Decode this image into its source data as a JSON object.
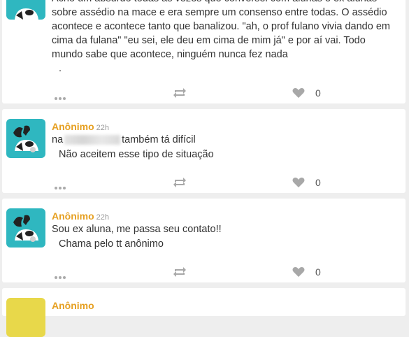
{
  "posts": [
    {
      "lines": [
        "Acho um absurdo todas as vezes que conversei com alunas e ex alunas",
        "sobre assédio na mace e era sempre um consenso entre todas. O assédio",
        "acontece e acontece tanto que banalizou. \"ah, o prof fulano vivia dando em",
        "cima da fulana\" \"eu sei, ele deu em cima de mim já\" e por aí vai. Todo",
        "mundo sabe que acontece, ninguém nunca fez nada"
      ],
      "trailing": ".",
      "likes": "0"
    },
    {
      "author": "Anônimo",
      "time": "22h",
      "line_prefix": "na",
      "line_suffix": "também tá difícil",
      "reply": "Não aceitem esse tipo de situação",
      "likes": "0"
    },
    {
      "author": "Anônimo",
      "time": "22h",
      "text": "Sou ex aluna, me passa seu contato!!",
      "reply": "Chama pelo tt anônimo",
      "likes": "0"
    },
    {
      "author": "Anônimo"
    }
  ],
  "icons": {
    "more": "more-dots-icon",
    "repost": "repost-icon",
    "like": "heart-icon"
  },
  "colors": {
    "author": "#e6a022",
    "avatar_bg": "#2fb7c0",
    "avatar_bg_alt": "#e8d84a",
    "icon": "#a8a8a8"
  }
}
